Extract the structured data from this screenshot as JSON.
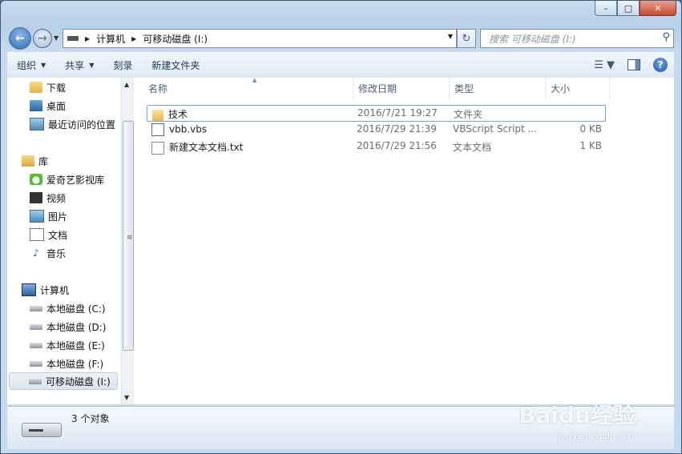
{
  "window": {
    "minimize_label": "–",
    "maximize_label": "□",
    "close_label": "✕"
  },
  "nav": {
    "back_icon": "arrow-left-icon",
    "forward_icon": "arrow-right-icon"
  },
  "address": {
    "crumbs": [
      "计算机",
      "可移动磁盘 (I:)"
    ]
  },
  "search": {
    "placeholder": "搜索 可移动磁盘 (I:)"
  },
  "toolbar": {
    "organize": "组织",
    "share": "共享",
    "burn": "刻录",
    "new_folder": "新建文件夹"
  },
  "sidebar": {
    "items": [
      {
        "label": "下载",
        "icon": "folder-download-icon"
      },
      {
        "label": "桌面",
        "icon": "desktop-icon"
      },
      {
        "label": "最近访问的位置",
        "icon": "recent-places-icon"
      },
      {
        "label": "库",
        "icon": "library-icon"
      },
      {
        "label": "爱奇艺影视库",
        "icon": "iqiyi-icon"
      },
      {
        "label": "视频",
        "icon": "video-icon"
      },
      {
        "label": "图片",
        "icon": "picture-icon"
      },
      {
        "label": "文档",
        "icon": "document-icon"
      },
      {
        "label": "音乐",
        "icon": "music-icon"
      },
      {
        "label": "计算机",
        "icon": "computer-icon"
      },
      {
        "label": "本地磁盘 (C:)",
        "icon": "system-drive-icon"
      },
      {
        "label": "本地磁盘 (D:)",
        "icon": "drive-icon"
      },
      {
        "label": "本地磁盘 (E:)",
        "icon": "drive-icon"
      },
      {
        "label": "本地磁盘 (F:)",
        "icon": "drive-icon"
      },
      {
        "label": "可移动磁盘 (I:)",
        "icon": "removable-drive-icon"
      }
    ]
  },
  "columns": {
    "name": "名称",
    "modified": "修改日期",
    "type": "类型",
    "size": "大小"
  },
  "files": [
    {
      "name": "技术",
      "modified": "2016/7/21 19:27",
      "type": "文件夹",
      "size": ""
    },
    {
      "name": "vbb.vbs",
      "modified": "2016/7/29 21:39",
      "type": "VBScript Script ...",
      "size": "0 KB"
    },
    {
      "name": "新建文本文档.txt",
      "modified": "2016/7/29 21:56",
      "type": "文本文档",
      "size": "1 KB"
    }
  ],
  "status": {
    "count_text": "3 个对象"
  },
  "watermark": {
    "brand": "Baidu经验",
    "url": "jingyan.baidu.com"
  }
}
